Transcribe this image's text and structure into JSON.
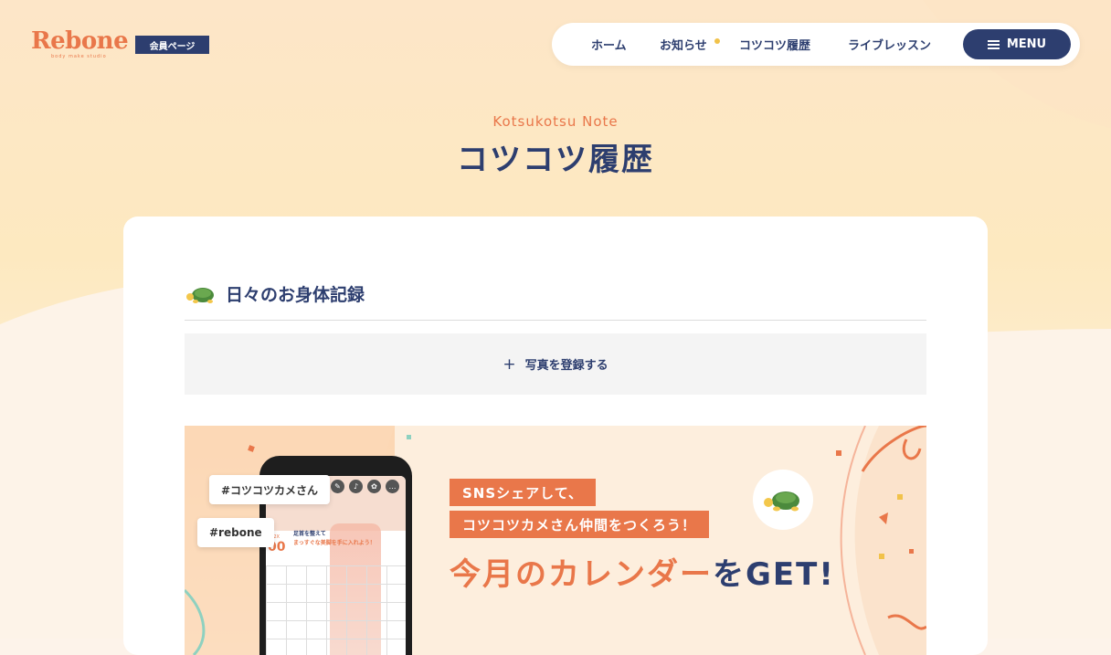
{
  "header": {
    "logo": "Rebone",
    "logo_sub": "body make studio",
    "member_badge": "会員ページ"
  },
  "nav": {
    "items": [
      {
        "label": "ホーム"
      },
      {
        "label": "お知らせ"
      },
      {
        "label": "コツコツ履歴"
      },
      {
        "label": "ライブレッスン"
      }
    ],
    "menu_label": "MENU"
  },
  "page": {
    "eyebrow": "Kotsukotsu Note",
    "title": "コツコツ履歴"
  },
  "section": {
    "title": "日々のお身体記録",
    "add_photo_label": "写真を登録する"
  },
  "banner": {
    "tag1": "#コツコツカメさん",
    "tag2": "#rebone",
    "line1": "SNSシェアして、",
    "line2": "コツコツカメさん仲間をつくろう！",
    "headline_part1": "今月のカレンダー",
    "headline_part2": "をGET!",
    "phone": {
      "year": "202X",
      "big": "00",
      "caption1": "足首を整えて",
      "caption2": "まっすぐな美脚を手に入れよう！"
    }
  },
  "colors": {
    "navy": "#2d3e6f",
    "orange": "#e9774a",
    "accent_yellow": "#f1c24a"
  }
}
